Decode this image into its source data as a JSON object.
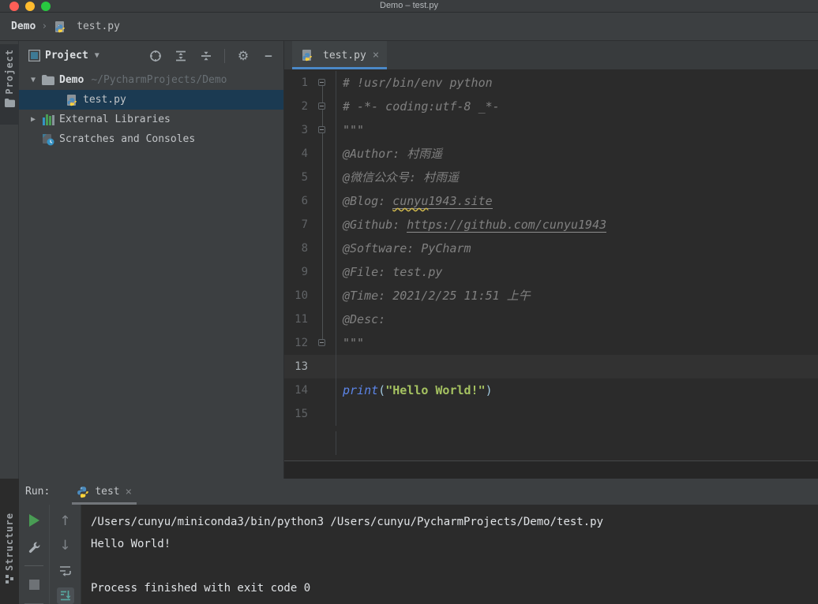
{
  "window": {
    "title": "Demo – test.py"
  },
  "breadcrumb": {
    "project": "Demo",
    "separator": "›",
    "file": "test.py"
  },
  "stripes": {
    "left_top": "Project",
    "left_bottom": "Structure"
  },
  "icons": {
    "dropdown_caret": "▼",
    "chevron_down": "▼",
    "chevron_right": "▶",
    "gear": "⚙",
    "hide": "—",
    "close": "×",
    "arrow_up": "↑",
    "arrow_down": "↓"
  },
  "project_panel": {
    "title": "Project",
    "toolbar_icons": [
      "locate",
      "expand-all",
      "collapse-all",
      "settings",
      "hide"
    ],
    "tree": [
      {
        "level": 0,
        "chevron": "down",
        "icon": "folder",
        "name": "Demo",
        "hint": "~/PycharmProjects/Demo",
        "bold": true,
        "selected": false
      },
      {
        "level": 1,
        "chevron": "none",
        "icon": "python-file",
        "name": "test.py",
        "hint": "",
        "bold": false,
        "selected": true
      },
      {
        "level": 0,
        "chevron": "right",
        "icon": "external-libraries",
        "name": "External Libraries",
        "hint": "",
        "bold": false,
        "selected": false
      },
      {
        "level": 0,
        "chevron": "none",
        "icon": "scratches",
        "name": "Scratches and Consoles",
        "hint": "",
        "bold": false,
        "selected": false
      }
    ]
  },
  "editor": {
    "tab": {
      "label": "test.py",
      "close": "×"
    },
    "lines": [
      {
        "n": "1",
        "fold": true,
        "current": false,
        "tokens": [
          {
            "t": "# !usr/bin/env python",
            "c": "comment"
          }
        ]
      },
      {
        "n": "2",
        "fold": true,
        "current": false,
        "tokens": [
          {
            "t": "# -*- coding:utf-8 _*-",
            "c": "comment"
          }
        ]
      },
      {
        "n": "3",
        "fold": true,
        "current": false,
        "tokens": [
          {
            "t": "\"\"\"",
            "c": "comment"
          }
        ]
      },
      {
        "n": "4",
        "fold": false,
        "current": false,
        "tokens": [
          {
            "t": "@Author: 村雨遥",
            "c": "comment"
          }
        ]
      },
      {
        "n": "5",
        "fold": false,
        "current": false,
        "tokens": [
          {
            "t": "@微信公众号: 村雨遥",
            "c": "comment"
          }
        ]
      },
      {
        "n": "6",
        "fold": false,
        "current": false,
        "tokens": [
          {
            "t": "@Blog: ",
            "c": "comment"
          },
          {
            "t": "cunyu",
            "c": "comment link typo"
          },
          {
            "t": "1943.site",
            "c": "comment link"
          }
        ]
      },
      {
        "n": "7",
        "fold": false,
        "current": false,
        "tokens": [
          {
            "t": "@Github: ",
            "c": "comment"
          },
          {
            "t": "https://github.com/cunyu1943",
            "c": "comment link"
          }
        ]
      },
      {
        "n": "8",
        "fold": false,
        "current": false,
        "tokens": [
          {
            "t": "@Software: PyCharm",
            "c": "comment"
          }
        ]
      },
      {
        "n": "9",
        "fold": false,
        "current": false,
        "tokens": [
          {
            "t": "@File: test.py",
            "c": "comment"
          }
        ]
      },
      {
        "n": "10",
        "fold": false,
        "current": false,
        "tokens": [
          {
            "t": "@Time: 2021/2/25 11:51 上午",
            "c": "comment"
          }
        ]
      },
      {
        "n": "11",
        "fold": false,
        "current": false,
        "tokens": [
          {
            "t": "@Desc: ",
            "c": "comment"
          }
        ]
      },
      {
        "n": "12",
        "fold": true,
        "current": false,
        "tokens": [
          {
            "t": "\"\"\"",
            "c": "comment"
          }
        ]
      },
      {
        "n": "13",
        "fold": false,
        "current": true,
        "tokens": []
      },
      {
        "n": "14",
        "fold": false,
        "current": false,
        "tokens": [
          {
            "t": "print",
            "c": "keyword"
          },
          {
            "t": "(",
            "c": "paren"
          },
          {
            "t": "\"Hello World!\"",
            "c": "string"
          },
          {
            "t": ")",
            "c": "paren"
          }
        ]
      },
      {
        "n": "15",
        "fold": false,
        "current": false,
        "tokens": []
      }
    ]
  },
  "run_panel": {
    "label": "Run:",
    "tab": {
      "label": "test",
      "close": "×"
    },
    "toolbar_main_icons": [
      "rerun",
      "settings-wrench",
      "stop"
    ],
    "toolbar_console_icons": [
      "arrow-up",
      "arrow-down",
      "soft-wrap",
      "scroll-to-end"
    ],
    "console_lines": [
      "/Users/cunyu/miniconda3/bin/python3 /Users/cunyu/PycharmProjects/Demo/test.py",
      "Hello World!",
      "",
      "Process finished with exit code 0"
    ]
  },
  "colors": {
    "accent_tab_underline": "#4A88C7",
    "tree_selection": "#1B3A52",
    "editor_bg": "#2B2B2B",
    "panel_bg": "#3C3F41",
    "comment": "#808080",
    "keyword": "#5C85E8",
    "string": "#A5C261",
    "console_text": "#E0E3E6",
    "run_play": "#499C54",
    "current_line": "#323232"
  }
}
